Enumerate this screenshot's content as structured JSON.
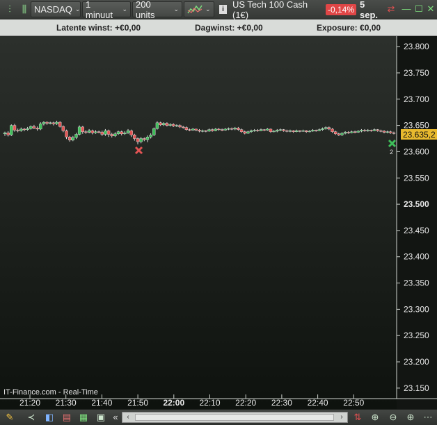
{
  "toolbar": {
    "market": "NASDAQ",
    "timeframe": "1 minuut",
    "units": "200 units",
    "instrument_info_icon": "info-icon",
    "instrument": "US Tech 100 Cash (1€)",
    "change": "-0,14%",
    "date": "5 sep.",
    "colors": {
      "negative": "#e04646",
      "positive": "#3fbf5a"
    }
  },
  "info": {
    "latent": "Latente winst: +€0,00",
    "day": "Dagwinst: +€0,00",
    "exposure": "Exposure: €0,00"
  },
  "chart": {
    "watermark": "IT-Finance.com - Real-Time",
    "current_price": "23.635,2",
    "marker_count": "2"
  },
  "chart_data": {
    "type": "candlestick",
    "y_ticks": [
      "23.800",
      "23.750",
      "23.700",
      "23.650",
      "23.600",
      "23.550",
      "23.500",
      "23.450",
      "23.400",
      "23.350",
      "23.300",
      "23.250",
      "23.200",
      "23.150"
    ],
    "y_ticks_values": [
      23800,
      23750,
      23700,
      23650,
      23600,
      23550,
      23500,
      23450,
      23400,
      23350,
      23300,
      23250,
      23200,
      23150
    ],
    "x_ticks": [
      "21:20",
      "21:30",
      "21:40",
      "21:50",
      "22:00",
      "22:10",
      "22:20",
      "22:30",
      "22:40",
      "22:50"
    ],
    "ylim": [
      23130,
      23820
    ],
    "current_price": 23635.2,
    "candles": [
      [
        23634,
        23636,
        23630,
        23638
      ],
      [
        23636,
        23632,
        23629,
        23639
      ],
      [
        23632,
        23650,
        23630,
        23652
      ],
      [
        23650,
        23641,
        23638,
        23653
      ],
      [
        23641,
        23640,
        23637,
        23644
      ],
      [
        23640,
        23643,
        23638,
        23646
      ],
      [
        23643,
        23642,
        23639,
        23645
      ],
      [
        23642,
        23644,
        23640,
        23647
      ],
      [
        23644,
        23648,
        23642,
        23650
      ],
      [
        23648,
        23645,
        23643,
        23651
      ],
      [
        23645,
        23643,
        23640,
        23648
      ],
      [
        23643,
        23653,
        23641,
        23656
      ],
      [
        23653,
        23656,
        23650,
        23658
      ],
      [
        23656,
        23654,
        23651,
        23658
      ],
      [
        23654,
        23655,
        23652,
        23657
      ],
      [
        23655,
        23653,
        23650,
        23657
      ],
      [
        23653,
        23656,
        23651,
        23659
      ],
      [
        23656,
        23648,
        23646,
        23658
      ],
      [
        23648,
        23640,
        23637,
        23650
      ],
      [
        23640,
        23628,
        23624,
        23642
      ],
      [
        23628,
        23622,
        23619,
        23630
      ],
      [
        23622,
        23627,
        23620,
        23630
      ],
      [
        23627,
        23633,
        23624,
        23636
      ],
      [
        23633,
        23647,
        23631,
        23650
      ],
      [
        23647,
        23638,
        23634,
        23649
      ],
      [
        23638,
        23637,
        23634,
        23641
      ],
      [
        23637,
        23640,
        23635,
        23643
      ],
      [
        23640,
        23636,
        23633,
        23642
      ],
      [
        23636,
        23638,
        23634,
        23641
      ],
      [
        23638,
        23637,
        23635,
        23640
      ],
      [
        23637,
        23633,
        23630,
        23640
      ],
      [
        23633,
        23640,
        23630,
        23643
      ],
      [
        23640,
        23633,
        23628,
        23642
      ],
      [
        23633,
        23630,
        23627,
        23636
      ],
      [
        23630,
        23634,
        23628,
        23637
      ],
      [
        23634,
        23638,
        23632,
        23640
      ],
      [
        23638,
        23634,
        23631,
        23640
      ],
      [
        23634,
        23636,
        23632,
        23639
      ],
      [
        23636,
        23640,
        23634,
        23643
      ],
      [
        23640,
        23632,
        23628,
        23642
      ],
      [
        23632,
        23625,
        23621,
        23634
      ],
      [
        23625,
        23619,
        23614,
        23627
      ],
      [
        23619,
        23625,
        23616,
        23628
      ],
      [
        23625,
        23623,
        23620,
        23627
      ],
      [
        23623,
        23628,
        23618,
        23631
      ],
      [
        23628,
        23632,
        23625,
        23635
      ],
      [
        23632,
        23644,
        23630,
        23646
      ],
      [
        23644,
        23655,
        23642,
        23658
      ],
      [
        23655,
        23651,
        23649,
        23657
      ],
      [
        23651,
        23654,
        23649,
        23656
      ],
      [
        23654,
        23650,
        23648,
        23656
      ],
      [
        23650,
        23652,
        23648,
        23654
      ],
      [
        23652,
        23649,
        23647,
        23654
      ],
      [
        23649,
        23650,
        23647,
        23652
      ],
      [
        23650,
        23647,
        23645,
        23652
      ],
      [
        23647,
        23646,
        23644,
        23649
      ],
      [
        23646,
        23642,
        23640,
        23648
      ],
      [
        23642,
        23641,
        23639,
        23644
      ],
      [
        23641,
        23643,
        23640,
        23645
      ],
      [
        23643,
        23641,
        23639,
        23644
      ],
      [
        23641,
        23639,
        23637,
        23643
      ],
      [
        23639,
        23640,
        23637,
        23642
      ],
      [
        23640,
        23639,
        23637,
        23641
      ],
      [
        23639,
        23642,
        23638,
        23644
      ],
      [
        23642,
        23640,
        23638,
        23644
      ],
      [
        23640,
        23643,
        23639,
        23645
      ],
      [
        23643,
        23642,
        23640,
        23645
      ],
      [
        23642,
        23641,
        23639,
        23644
      ],
      [
        23641,
        23643,
        23640,
        23645
      ],
      [
        23643,
        23644,
        23641,
        23646
      ],
      [
        23644,
        23643,
        23641,
        23646
      ],
      [
        23643,
        23645,
        23641,
        23647
      ],
      [
        23645,
        23642,
        23640,
        23647
      ],
      [
        23642,
        23638,
        23636,
        23644
      ],
      [
        23638,
        23635,
        23633,
        23640
      ],
      [
        23635,
        23638,
        23634,
        23640
      ],
      [
        23638,
        23640,
        23636,
        23642
      ],
      [
        23640,
        23641,
        23638,
        23643
      ],
      [
        23641,
        23640,
        23638,
        23643
      ],
      [
        23640,
        23642,
        23639,
        23644
      ],
      [
        23642,
        23641,
        23639,
        23643
      ],
      [
        23641,
        23643,
        23640,
        23645
      ],
      [
        23643,
        23638,
        23636,
        23644
      ],
      [
        23638,
        23639,
        23637,
        23641
      ],
      [
        23639,
        23641,
        23637,
        23643
      ],
      [
        23641,
        23642,
        23639,
        23644
      ],
      [
        23642,
        23640,
        23638,
        23643
      ],
      [
        23640,
        23639,
        23637,
        23642
      ],
      [
        23639,
        23640,
        23637,
        23642
      ],
      [
        23640,
        23638,
        23636,
        23641
      ],
      [
        23638,
        23640,
        23637,
        23642
      ],
      [
        23640,
        23639,
        23637,
        23641
      ],
      [
        23639,
        23640,
        23638,
        23642
      ],
      [
        23640,
        23638,
        23636,
        23641
      ],
      [
        23638,
        23639,
        23637,
        23641
      ],
      [
        23639,
        23641,
        23638,
        23643
      ],
      [
        23641,
        23640,
        23638,
        23642
      ],
      [
        23640,
        23642,
        23639,
        23644
      ],
      [
        23642,
        23644,
        23640,
        23646
      ],
      [
        23644,
        23646,
        23642,
        23648
      ],
      [
        23646,
        23643,
        23641,
        23648
      ],
      [
        23643,
        23638,
        23636,
        23645
      ],
      [
        23638,
        23634,
        23632,
        23640
      ],
      [
        23634,
        23632,
        23630,
        23636
      ],
      [
        23632,
        23635,
        23630,
        23637
      ],
      [
        23635,
        23637,
        23633,
        23639
      ],
      [
        23637,
        23636,
        23634,
        23639
      ],
      [
        23636,
        23638,
        23635,
        23640
      ],
      [
        23638,
        23637,
        23635,
        23640
      ],
      [
        23637,
        23639,
        23636,
        23641
      ],
      [
        23639,
        23641,
        23637,
        23643
      ],
      [
        23641,
        23640,
        23638,
        23643
      ],
      [
        23640,
        23641,
        23638,
        23643
      ],
      [
        23641,
        23640,
        23638,
        23642
      ],
      [
        23640,
        23642,
        23639,
        23644
      ],
      [
        23642,
        23640,
        23638,
        23643
      ],
      [
        23640,
        23639,
        23637,
        23642
      ],
      [
        23639,
        23637,
        23635,
        23641
      ],
      [
        23637,
        23638,
        23635,
        23640
      ],
      [
        23638,
        23636,
        23634,
        23640
      ],
      [
        23636,
        23635,
        23633,
        23638
      ]
    ]
  }
}
